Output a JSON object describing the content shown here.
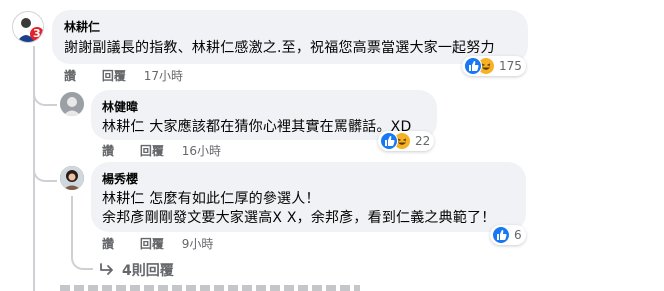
{
  "comments": [
    {
      "author": "林耕仁",
      "text": "謝謝副議長的指教、林耕仁感激之.至，祝福您高票當選大家一起努力",
      "actions": {
        "like": "讚",
        "reply": "回覆",
        "time": "17小時"
      },
      "reaction_count": "175",
      "reactions": [
        "like-icon",
        "haha-icon"
      ],
      "avatar_badge": "3"
    },
    {
      "author": "林健暐",
      "mention": "林耕仁",
      "text": " 大家應該都在猜你心裡其實在罵髒話。XD",
      "actions": {
        "like": "讚",
        "reply": "回覆",
        "time": "16小時"
      },
      "reaction_count": "22",
      "reactions": [
        "like-icon",
        "haha-icon"
      ]
    },
    {
      "author": "楊秀櫻",
      "mention": "林耕仁",
      "text_line1": " 怎麼有如此仁厚的參選人！",
      "text_line2": "余邦彥剛剛發文要大家選高X X，余邦彥，看到仁義之典範了！",
      "actions": {
        "like": "讚",
        "reply": "回覆",
        "time": "9小時"
      },
      "reaction_count": "6",
      "reactions": [
        "like-icon"
      ]
    }
  ],
  "more_replies": "4則回覆",
  "colors": {
    "bubble": "#f0f2f5",
    "like": "#1877f2",
    "haha": "#f7b125",
    "meta": "#65676b"
  }
}
